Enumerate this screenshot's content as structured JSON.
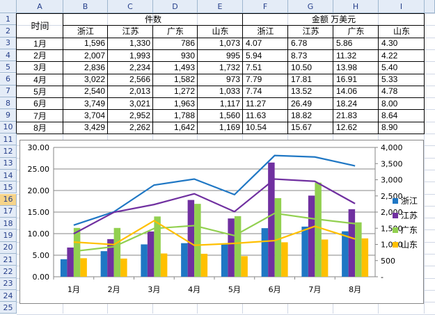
{
  "columns": [
    "A",
    "B",
    "C",
    "D",
    "E",
    "F",
    "G",
    "H",
    "I"
  ],
  "rows": [
    "1",
    "2",
    "3",
    "4",
    "5",
    "6",
    "7",
    "8",
    "9",
    "10",
    "11",
    "12",
    "13",
    "14",
    "15",
    "16",
    "17",
    "18",
    "19",
    "20",
    "21",
    "22",
    "23",
    "24",
    "25"
  ],
  "selected_row": "16",
  "table": {
    "time_label": "时间",
    "group_pieces": "件数",
    "group_amount": "金额 万美元",
    "regions": [
      "浙江",
      "江苏",
      "广东",
      "山东"
    ],
    "data_rows": [
      {
        "month": "1月",
        "pieces": [
          "1,596",
          "1,330",
          "786",
          "1,073"
        ],
        "amount": [
          "4.07",
          "6.78",
          "5.86",
          "4.30"
        ]
      },
      {
        "month": "2月",
        "pieces": [
          "2,007",
          "1,993",
          "930",
          "995"
        ],
        "amount": [
          "5.94",
          "8.73",
          "11.32",
          "4.22"
        ]
      },
      {
        "month": "3月",
        "pieces": [
          "2,836",
          "2,234",
          "1,493",
          "1,732"
        ],
        "amount": [
          "7.51",
          "10.50",
          "13.98",
          "5.40"
        ]
      },
      {
        "month": "4月",
        "pieces": [
          "3,022",
          "2,566",
          "1,582",
          "973"
        ],
        "amount": [
          "7.79",
          "17.81",
          "16.91",
          "5.33"
        ]
      },
      {
        "month": "5月",
        "pieces": [
          "2,540",
          "2,013",
          "1,272",
          "1,033"
        ],
        "amount": [
          "7.74",
          "13.52",
          "14.06",
          "4.78"
        ]
      },
      {
        "month": "6月",
        "pieces": [
          "3,749",
          "3,021",
          "1,963",
          "1,117"
        ],
        "amount": [
          "11.27",
          "26.49",
          "18.24",
          "8.00"
        ]
      },
      {
        "month": "7月",
        "pieces": [
          "3,704",
          "2,952",
          "1,788",
          "1,560"
        ],
        "amount": [
          "11.63",
          "18.82",
          "21.83",
          "8.64"
        ]
      },
      {
        "month": "8月",
        "pieces": [
          "3,429",
          "2,262",
          "1,642",
          "1,169"
        ],
        "amount": [
          "10.54",
          "15.67",
          "12.62",
          "8.90"
        ]
      }
    ]
  },
  "chart_data": {
    "type": "bar",
    "categories": [
      "1月",
      "2月",
      "3月",
      "4月",
      "5月",
      "6月",
      "7月",
      "8月"
    ],
    "series": [
      {
        "name": "浙江",
        "type": "bar",
        "axis": "left",
        "color": "#1f77c4",
        "values": [
          4.07,
          5.94,
          7.51,
          7.79,
          7.74,
          11.27,
          11.63,
          10.54
        ]
      },
      {
        "name": "江苏",
        "type": "bar",
        "axis": "left",
        "color": "#7030a0",
        "values": [
          6.78,
          8.73,
          10.5,
          17.81,
          13.52,
          26.49,
          18.82,
          15.67
        ]
      },
      {
        "name": "广东",
        "type": "bar",
        "axis": "left",
        "color": "#92d050",
        "values": [
          11.32,
          11.32,
          13.98,
          16.91,
          14.06,
          18.24,
          21.83,
          12.62
        ]
      },
      {
        "name": "山东",
        "type": "bar",
        "axis": "left",
        "color": "#ffc000",
        "values": [
          4.3,
          4.22,
          5.4,
          5.33,
          4.78,
          8.0,
          8.64,
          8.9
        ]
      },
      {
        "name": "浙江",
        "type": "line",
        "axis": "right",
        "color": "#1f77c4",
        "values": [
          1596,
          2007,
          2836,
          3022,
          2540,
          3749,
          3704,
          3429
        ]
      },
      {
        "name": "江苏",
        "type": "line",
        "axis": "right",
        "color": "#7030a0",
        "values": [
          1330,
          1993,
          2234,
          2566,
          2013,
          3021,
          2952,
          2262
        ]
      },
      {
        "name": "广东",
        "type": "line",
        "axis": "right",
        "color": "#92d050",
        "values": [
          786,
          930,
          1493,
          1582,
          1272,
          1963,
          1788,
          1642
        ]
      },
      {
        "name": "山东",
        "type": "line",
        "axis": "right",
        "color": "#ffc000",
        "values": [
          1073,
          995,
          1732,
          973,
          1033,
          1117,
          1560,
          1169
        ]
      }
    ],
    "ylim_left": [
      0,
      30
    ],
    "yticks_left": [
      "0.00",
      "5.00",
      "10.00",
      "15.00",
      "20.00",
      "25.00",
      "30.00"
    ],
    "ylim_right": [
      0,
      4000
    ],
    "yticks_right": [
      "-",
      "500",
      "1,000",
      "1,500",
      "2,000",
      "2,500",
      "3,000",
      "3,500",
      "4,000"
    ],
    "legend": [
      "浙江",
      "江苏",
      "广东",
      "山东"
    ],
    "legend_colors": [
      "#1f77c4",
      "#7030a0",
      "#92d050",
      "#ffc000"
    ],
    "legend_position": "right",
    "grid": true
  }
}
